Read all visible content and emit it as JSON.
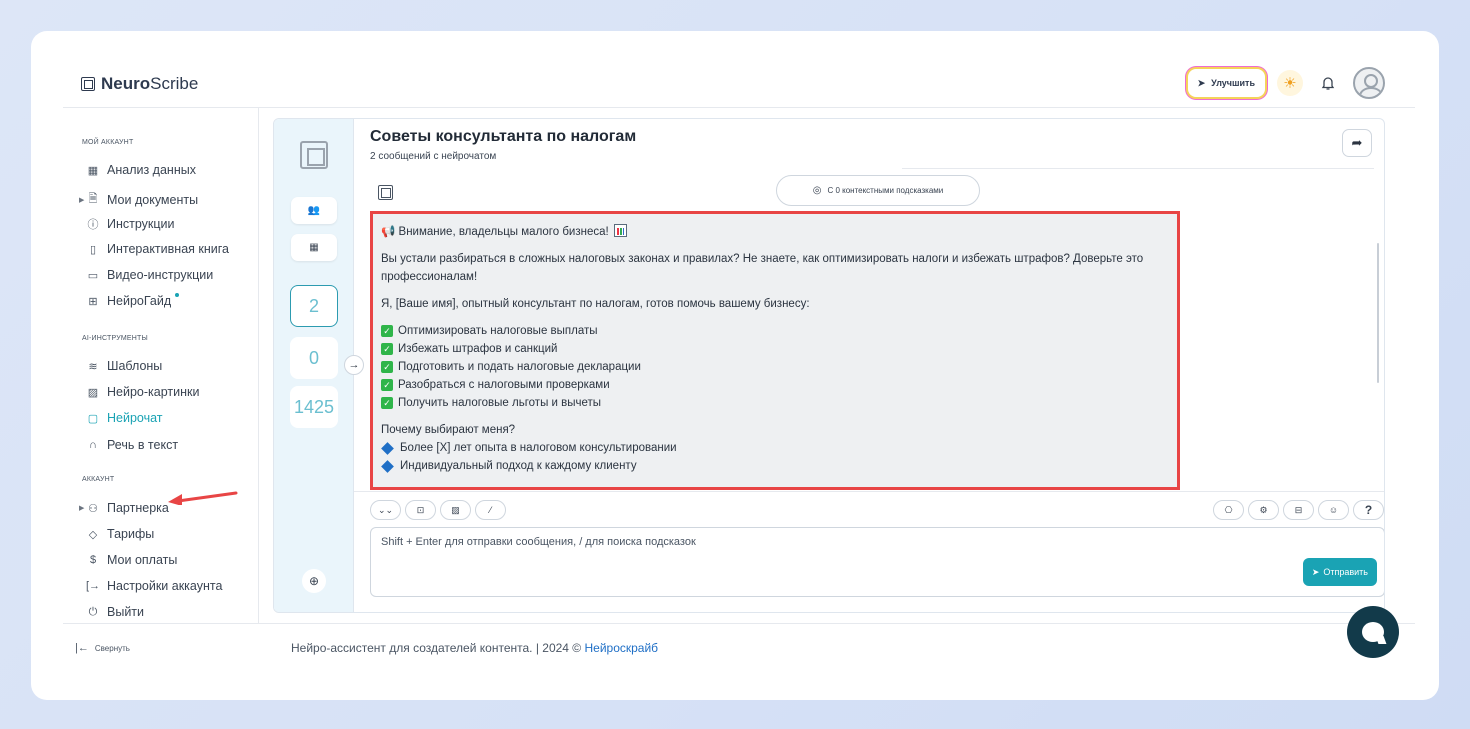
{
  "app": {
    "brand_bold": "Neuro",
    "brand_light": "Scribe"
  },
  "header": {
    "upgrade_label": "Улучшить"
  },
  "sidebar": {
    "section_account": "МОЙ АККАУНТ",
    "section_ai": "AI-ИНСТРУМЕНТЫ",
    "section_acc2": "АККАУНТ",
    "items": [
      {
        "label": "Анализ данных",
        "icon": "grid-icon"
      },
      {
        "label": "Мои документы",
        "icon": "document-icon"
      },
      {
        "label": "Инструкции",
        "icon": "help-circle-icon"
      },
      {
        "label": "Интерактивная книга",
        "icon": "book-icon"
      },
      {
        "label": "Видео-инструкции",
        "icon": "video-icon"
      },
      {
        "label": "НейроГайд",
        "icon": "guide-icon"
      },
      {
        "label": "Шаблоны",
        "icon": "layers-icon"
      },
      {
        "label": "Нейро-картинки",
        "icon": "image-icon"
      },
      {
        "label": "Нейрочат",
        "icon": "chat-icon"
      },
      {
        "label": "Речь в текст",
        "icon": "headphones-icon"
      },
      {
        "label": "Партнерка",
        "icon": "users-icon"
      },
      {
        "label": "Тарифы",
        "icon": "tag-icon"
      },
      {
        "label": "Мои оплаты",
        "icon": "dollar-icon"
      },
      {
        "label": "Настройки аккаунта",
        "icon": "settings-login-icon"
      },
      {
        "label": "Выйти",
        "icon": "power-icon"
      }
    ],
    "collapse_label": "Свернуть"
  },
  "rail": {
    "count_messages": "2",
    "count_zero": "0",
    "count_tokens": "1425"
  },
  "chat": {
    "title": "Советы консультанта по налогам",
    "subtitle": "2 сообщений с нейрочатом",
    "context_label": "С 0 контекстными подсказками",
    "message": {
      "line1": "Внимание, владельцы малого бизнеса!",
      "line2": "Вы устали разбираться в сложных налоговых законах и правилах? Не знаете, как оптимизировать налоги и избежать штрафов? Доверьте это профессионалам!",
      "line3": "Я, [Ваше имя], опытный консультант по налогам, готов помочь вашему бизнесу:",
      "checks": [
        "Оптимизировать налоговые выплаты",
        "Избежать штрафов и санкций",
        "Подготовить и подать налоговые декларации",
        "Разобраться с налоговыми проверками",
        "Получить налоговые льготы и вычеты"
      ],
      "why": "Почему выбирают меня?",
      "bullets": [
        "Более [X] лет опыта в налоговом консультировании",
        "Индивидуальный подход к каждому клиенту"
      ]
    },
    "input_placeholder": "Shift + Enter для отправки сообщения, / для поиска подсказок",
    "send_label": "Отправить"
  },
  "footer": {
    "text": "Нейро-ассистент для создателей контента.  | 2024 © ",
    "link": "Нейроскрайб"
  }
}
